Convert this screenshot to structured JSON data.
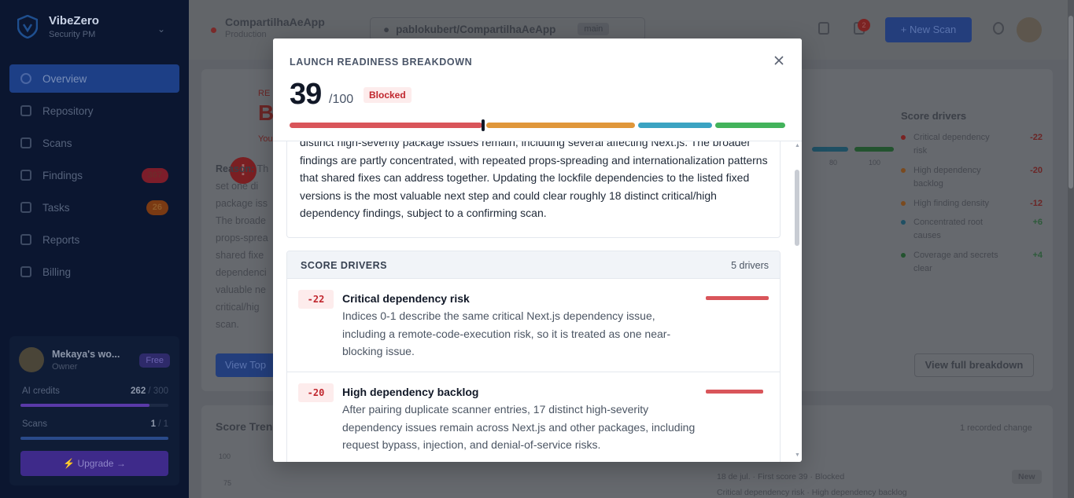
{
  "app": {
    "name": "VibeZero",
    "subtitle": "Security PM"
  },
  "sidebar": {
    "items": [
      {
        "label": "Overview",
        "icon": "grid-icon",
        "active": true
      },
      {
        "label": "Repository",
        "icon": "branch-icon"
      },
      {
        "label": "Scans",
        "icon": "radar-icon"
      },
      {
        "label": "Findings",
        "icon": "alert-icon",
        "badge": "367"
      },
      {
        "label": "Tasks",
        "icon": "list-icon",
        "badge": "26"
      },
      {
        "label": "Reports",
        "icon": "document-icon"
      },
      {
        "label": "Billing",
        "icon": "card-icon"
      }
    ],
    "workspace": {
      "name": "Mekaya's wo...",
      "role": "Owner",
      "plan": "Free",
      "ai_credits_label": "AI credits",
      "ai_credits_value": "262",
      "ai_credits_total": "/ 300",
      "ai_credits_fraction": 0.87,
      "scans_label": "Scans",
      "scans_value": "1",
      "scans_total": "/ 1",
      "scans_fraction": 1.0,
      "upgrade_label": "⚡ Upgrade →"
    }
  },
  "topbar": {
    "project_name": "CompartilhaAeApp",
    "project_env": "Production",
    "repo": "pablokubert/CompartilhaAeApp",
    "branch": "main",
    "notifications": "2",
    "new_scan_label": "+ New Scan"
  },
  "background": {
    "status_label": "RE",
    "status_letter": "B",
    "status_sub": "You",
    "reason_label": "Reason:",
    "reason_lines": [
      "Th",
      "set one di",
      "package iss",
      "The broade",
      "props-sprea",
      "shared fixe",
      "dependenci",
      "valuable ne",
      "critical/hig",
      "scan."
    ],
    "view_top_label": "View Top",
    "score_drivers_title": "Score drivers",
    "view_full_label": "View full breakdown",
    "axis_80": "80",
    "axis_100": "100",
    "score_trend_title": "Score Trend",
    "recorded_change": "1 recorded change",
    "trend_100": "100",
    "trend_75": "75",
    "history_line": "18 de jul. · First score 39 · Blocked",
    "history_sub": "Critical dependency risk · High dependency backlog",
    "history_tag": "New",
    "drivers": [
      {
        "label": "Critical dependency risk",
        "value": "-22",
        "color": "#7a2323"
      },
      {
        "label": "High dependency backlog",
        "value": "-20",
        "color": "#7a4a1f"
      },
      {
        "label": "High finding density",
        "value": "-12",
        "color": "#7a4a1f"
      },
      {
        "label": "Concentrated root causes",
        "value": "+6",
        "color": "#1f4f63"
      },
      {
        "label": "Coverage and secrets clear",
        "value": "+4",
        "color": "#23532f"
      }
    ]
  },
  "modal": {
    "title": "LAUNCH READINESS BREAKDOWN",
    "score": "39",
    "score_max": "/100",
    "status": "Blocked",
    "score_value": 39,
    "segments": [
      {
        "name": "blocked",
        "color": "#d9555a"
      },
      {
        "name": "at-risk",
        "color": "#e0973a"
      },
      {
        "name": "ready-with-work",
        "color": "#3ba3c2"
      },
      {
        "name": "ready",
        "color": "#43b35b"
      }
    ],
    "summary": "distinct high-severity package issues remain, including several affecting Next.js. The broader findings are partly concentrated, with repeated props-spreading and internationalization patterns that shared fixes can address together. Updating the lockfile dependencies to the listed fixed versions is the most valuable next step and could clear roughly 18 distinct critical/high dependency findings, subject to a confirming scan.",
    "drivers_title": "SCORE DRIVERS",
    "drivers_count": "5 drivers",
    "drivers": [
      {
        "impact": "-22",
        "title": "Critical dependency risk",
        "description": "Indices 0-1 describe the same critical Next.js dependency issue, including a remote-code-execution risk, so it is treated as one near-blocking issue.",
        "weight": 1.0
      },
      {
        "impact": "-20",
        "title": "High dependency backlog",
        "description": "After pairing duplicate scanner entries, 17 distinct high-severity dependency issues remain across Next.js and other packages, including request bypass, injection, and denial-of-service risks.",
        "weight": 0.91
      }
    ]
  }
}
